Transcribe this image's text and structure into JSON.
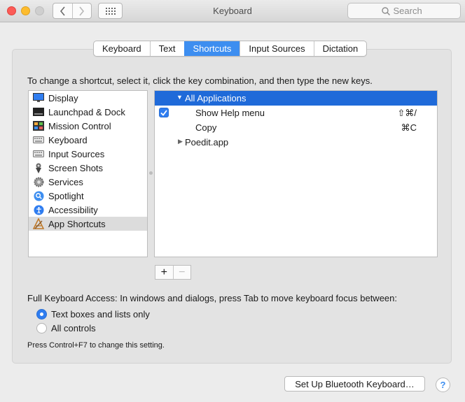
{
  "window": {
    "title": "Keyboard"
  },
  "search": {
    "placeholder": "Search"
  },
  "tabs": [
    {
      "label": "Keyboard",
      "active": false
    },
    {
      "label": "Text",
      "active": false
    },
    {
      "label": "Shortcuts",
      "active": true
    },
    {
      "label": "Input Sources",
      "active": false
    },
    {
      "label": "Dictation",
      "active": false
    }
  ],
  "instruction": "To change a shortcut, select it, click the key combination, and then type the new keys.",
  "categories": [
    {
      "label": "Display",
      "icon": "display-icon"
    },
    {
      "label": "Launchpad & Dock",
      "icon": "launchpad-icon"
    },
    {
      "label": "Mission Control",
      "icon": "mission-control-icon"
    },
    {
      "label": "Keyboard",
      "icon": "keyboard-icon"
    },
    {
      "label": "Input Sources",
      "icon": "keyboard-icon"
    },
    {
      "label": "Screen Shots",
      "icon": "screenshot-icon"
    },
    {
      "label": "Services",
      "icon": "gear-icon"
    },
    {
      "label": "Spotlight",
      "icon": "spotlight-icon"
    },
    {
      "label": "Accessibility",
      "icon": "accessibility-icon"
    },
    {
      "label": "App Shortcuts",
      "icon": "app-shortcuts-icon",
      "selected": true
    }
  ],
  "shortcuts": {
    "group_all": "All Applications",
    "items": [
      {
        "label": "Show Help menu",
        "keys": "⇧⌘/",
        "checked": true
      },
      {
        "label": "Copy",
        "keys": "⌘C",
        "checked": false
      }
    ],
    "group_app": "Poedit.app"
  },
  "buttons": {
    "add": "+",
    "remove": "−",
    "bluetooth": "Set Up Bluetooth Keyboard…",
    "help": "?"
  },
  "full_keyboard_access": {
    "label": "Full Keyboard Access: In windows and dialogs, press Tab to move keyboard focus between:",
    "options": [
      {
        "label": "Text boxes and lists only",
        "selected": true
      },
      {
        "label": "All controls",
        "selected": false
      }
    ],
    "hint": "Press Control+F7 to change this setting."
  },
  "colors": {
    "accent": "#2f7df0",
    "selection": "#1f6ad9",
    "close": "#fc5b57",
    "minimize": "#fdbc2e"
  }
}
